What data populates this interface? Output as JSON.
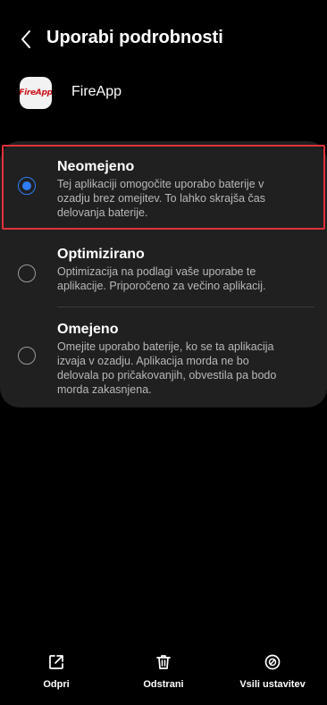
{
  "header": {
    "title": "Uporabi podrobnosti",
    "back_icon": "chevron-left-icon"
  },
  "app": {
    "name": "FireApp",
    "logo_text": "FireApp",
    "logo_color": "#c8161d"
  },
  "options": [
    {
      "title": "Neomejeno",
      "description": "Tej aplikaciji omogočite uporabo baterije v ozadju brez omejitev. To lahko skrajša čas delovanja baterije.",
      "selected": true
    },
    {
      "title": "Optimizirano",
      "description": "Optimizacija na podlagi vaše uporabe te aplikacije. Priporočeno za večino aplikacij.",
      "selected": false
    },
    {
      "title": "Omejeno",
      "description": "Omejite uporabo baterije, ko se ta aplikacija izvaja v ozadju. Aplikacija morda ne bo delovala po pričakovanjih, obvestila pa bodo morda zakasnjena.",
      "selected": false
    }
  ],
  "bottom_bar": {
    "items": [
      {
        "label": "Odpri",
        "icon": "open-external-icon"
      },
      {
        "label": "Odstrani",
        "icon": "trash-icon"
      },
      {
        "label": "Vsili ustavitev",
        "icon": "block-icon"
      }
    ]
  },
  "colors": {
    "background": "#000000",
    "card": "#202020",
    "accent": "#2f7cf6",
    "highlight": "#e0323b"
  }
}
